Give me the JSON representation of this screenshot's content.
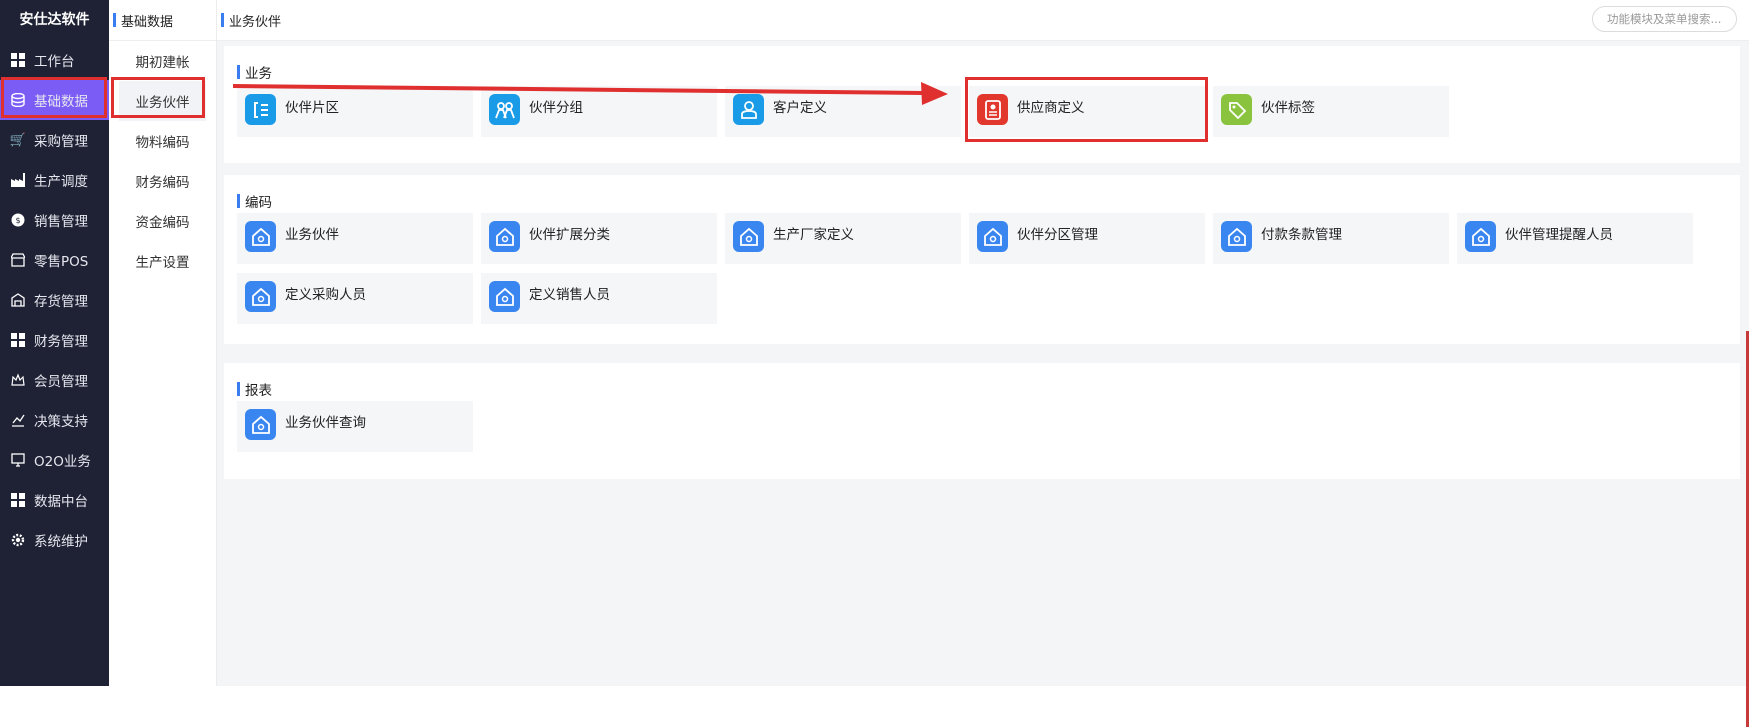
{
  "brand": "安仕达软件",
  "nav": {
    "items": [
      {
        "label": "工作台",
        "icon": "grid-icon"
      },
      {
        "label": "基础数据",
        "icon": "database-icon"
      },
      {
        "label": "采购管理",
        "icon": "cart-icon"
      },
      {
        "label": "生产调度",
        "icon": "factory-icon"
      },
      {
        "label": "销售管理",
        "icon": "sales-icon"
      },
      {
        "label": "零售POS",
        "icon": "store-icon"
      },
      {
        "label": "存货管理",
        "icon": "warehouse-icon"
      },
      {
        "label": "财务管理",
        "icon": "grid-icon"
      },
      {
        "label": "会员管理",
        "icon": "crown-icon"
      },
      {
        "label": "决策支持",
        "icon": "chart-icon"
      },
      {
        "label": "O2O业务",
        "icon": "monitor-icon"
      },
      {
        "label": "数据中台",
        "icon": "grid-icon"
      },
      {
        "label": "系统维护",
        "icon": "gear-icon"
      }
    ]
  },
  "sub": {
    "title": "基础数据",
    "items": [
      "期初建帐",
      "业务伙伴",
      "物料编码",
      "财务编码",
      "资金编码",
      "生产设置"
    ]
  },
  "breadcrumb": "业务伙伴",
  "search": {
    "placeholder": "功能模块及菜单搜索..."
  },
  "sections": {
    "business": {
      "title": "业务",
      "tiles": [
        {
          "label": "伙伴片区",
          "icon": "partner-area-icon"
        },
        {
          "label": "伙伴分组",
          "icon": "partner-group-icon"
        },
        {
          "label": "客户定义",
          "icon": "customer-icon"
        },
        {
          "label": "供应商定义",
          "icon": "supplier-icon"
        },
        {
          "label": "伙伴标签",
          "icon": "tag-icon"
        }
      ]
    },
    "coding": {
      "title": "编码",
      "tiles": [
        {
          "label": "业务伙伴",
          "icon": "house-icon"
        },
        {
          "label": "伙伴扩展分类",
          "icon": "house-icon"
        },
        {
          "label": "生产厂家定义",
          "icon": "house-icon"
        },
        {
          "label": "伙伴分区管理",
          "icon": "house-icon"
        },
        {
          "label": "付款条款管理",
          "icon": "house-icon"
        },
        {
          "label": "伙伴管理提醒人员",
          "icon": "house-icon"
        },
        {
          "label": "定义采购人员",
          "icon": "house-icon"
        },
        {
          "label": "定义销售人员",
          "icon": "house-icon"
        }
      ]
    },
    "reports": {
      "title": "报表",
      "tiles": [
        {
          "label": "业务伙伴查询",
          "icon": "house-icon"
        }
      ]
    }
  },
  "colors": {
    "nav_bg": "#1f2234",
    "nav_active": "#7b5cf5",
    "accent": "#3a7df0",
    "highlight": "#e02f2f",
    "tag_green": "#8ac43f"
  }
}
